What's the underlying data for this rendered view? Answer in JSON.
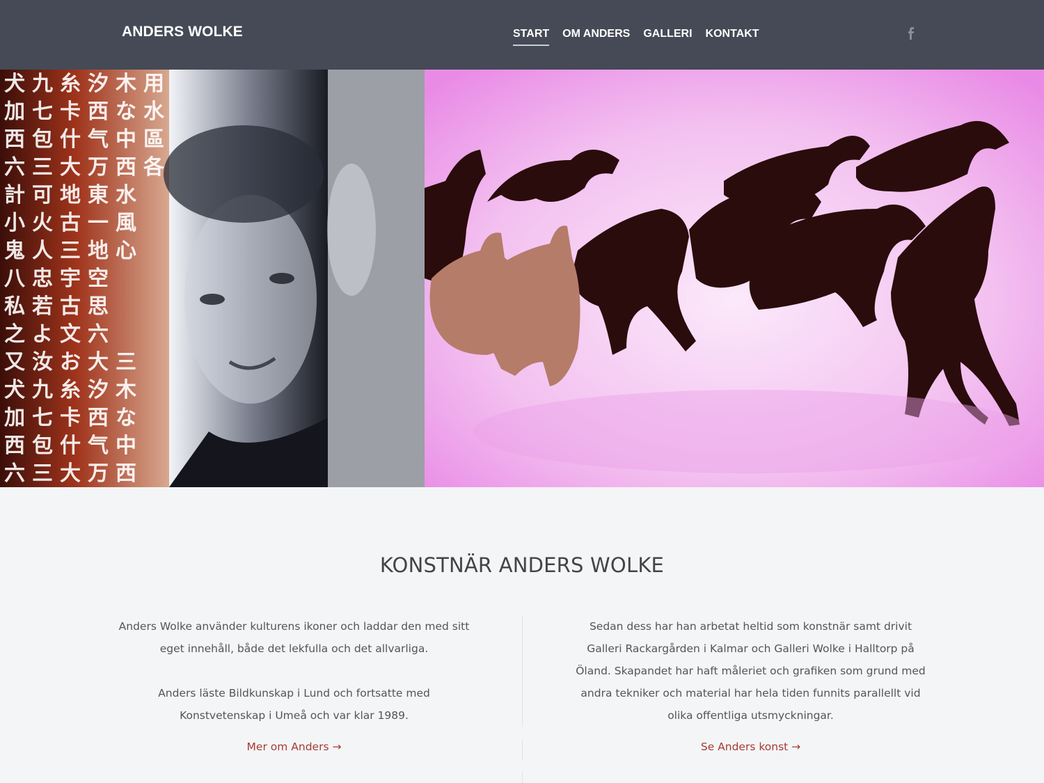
{
  "header": {
    "logo": "ANDERS WOLKE",
    "nav": [
      {
        "label": "START",
        "active": true
      },
      {
        "label": "OM ANDERS",
        "active": false
      },
      {
        "label": "GALLERI",
        "active": false
      },
      {
        "label": "KONTAKT",
        "active": false
      }
    ],
    "social_icon": "facebook-icon"
  },
  "hero": {
    "glyph_rows": [
      "犬九糸汐木用",
      "加七卡西な水",
      "西包什气中區",
      "六三大万西各",
      "計可地東水",
      "小火古一風",
      "鬼人三地心",
      "八忠宇空",
      "私若古思",
      "之よ文六",
      "又汝お大三",
      "犬九糸汐木",
      "加七卡西な",
      "西包什气中",
      "六三大万西"
    ],
    "colors": {
      "pink": "#e98be6",
      "red": "#a0341c",
      "dark": "#1e1f28"
    }
  },
  "main": {
    "title": "KONSTNÄR ANDERS WOLKE",
    "left_paragraphs": [
      "Anders Wolke använder kulturens ikoner och laddar den med sitt eget innehåll, både det lekfulla och det allvarliga.",
      "Anders läste Bildkunskap i Lund och fortsatte med Konstvetenskap i Umeå och var klar 1989."
    ],
    "right_paragraphs": [
      "Sedan dess har han arbetat heltid som konstnär samt drivit Galleri Rackargården i Kalmar och Galleri Wolke i Halltorp på Öland. Skapandet har haft måleriet och grafiken som grund med andra tekniker och material har hela tiden funnits parallellt vid olika offentliga utsmyckningar."
    ],
    "left_link": "Mer om Anders →",
    "right_link": "Se Anders konst →"
  },
  "colors": {
    "header_bg": "#454a56",
    "link": "#a63a36",
    "page_bg": "#f4f5f6"
  }
}
